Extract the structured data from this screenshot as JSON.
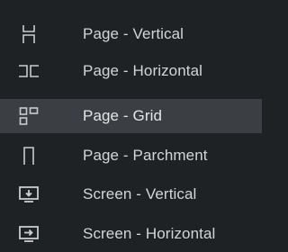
{
  "menu": {
    "selected_index": 2,
    "items": [
      {
        "label": "Page - Vertical",
        "icon": "page-vertical-icon"
      },
      {
        "label": "Page - Horizontal",
        "icon": "page-horizontal-icon"
      },
      {
        "label": "Page - Grid",
        "icon": "page-grid-icon"
      },
      {
        "label": "Page - Parchment",
        "icon": "page-parchment-icon"
      },
      {
        "label": "Screen - Vertical",
        "icon": "screen-vertical-icon"
      },
      {
        "label": "Screen - Horizontal",
        "icon": "screen-horizontal-icon"
      }
    ]
  },
  "colors": {
    "background": "#1f2224",
    "selected_background": "#3b3f43",
    "text": "#d3d6d9",
    "icon": "#c9ccd0"
  }
}
